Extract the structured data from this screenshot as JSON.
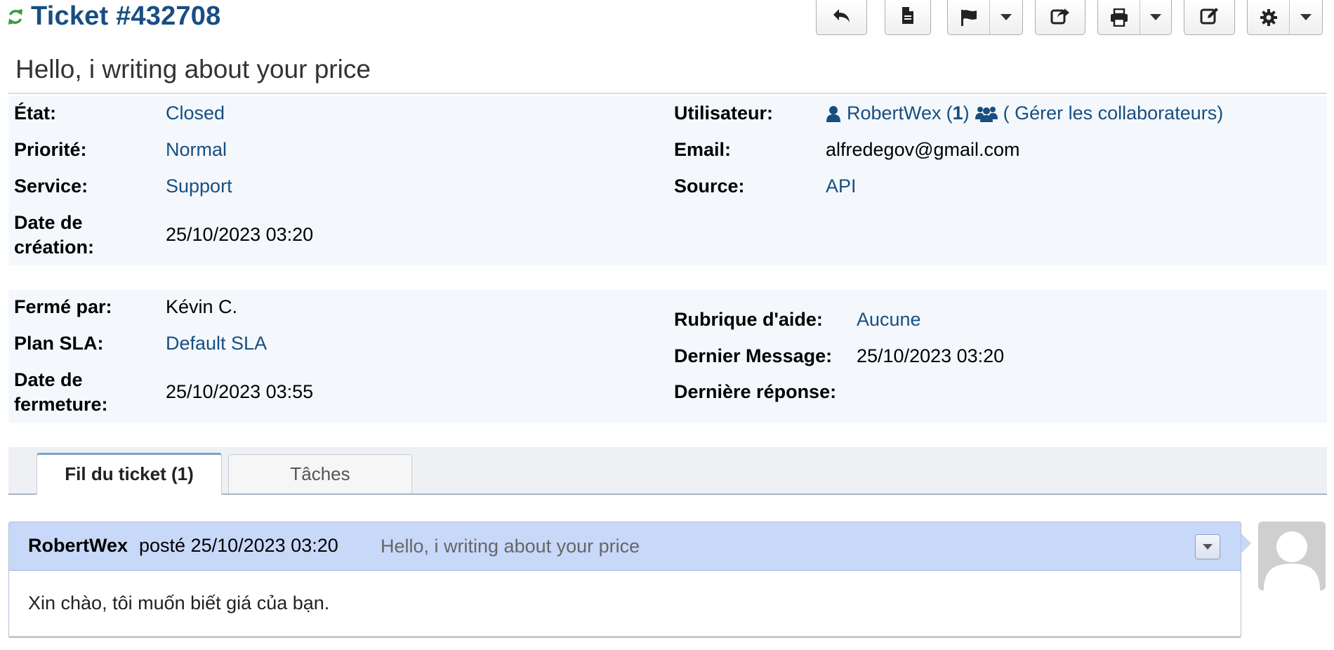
{
  "header": {
    "title": "Ticket #432708",
    "refresh_icon": "refresh-icon",
    "actions": [
      {
        "name": "reply",
        "icon": "reply-icon"
      },
      {
        "name": "note",
        "icon": "document-icon"
      },
      {
        "name": "flag",
        "icon": "flag-icon",
        "dropdown": true
      },
      {
        "name": "transfer",
        "icon": "share-icon"
      },
      {
        "name": "print",
        "icon": "print-icon",
        "dropdown": true
      },
      {
        "name": "edit",
        "icon": "edit-icon"
      },
      {
        "name": "settings",
        "icon": "gear-icon",
        "dropdown": true
      }
    ]
  },
  "subject": "Hello, i writing about your price",
  "info": {
    "state_label": "État:",
    "state_value": "Closed",
    "priority_label": "Priorité:",
    "priority_value": "Normal",
    "service_label": "Service:",
    "service_value": "Support",
    "created_label_1": "Date de",
    "created_label_2": "création:",
    "created_value": "25/10/2023 03:20",
    "user_label": "Utilisateur:",
    "user_name": "RobertWex",
    "user_count_open": "(",
    "user_count": "1",
    "user_count_close": ")",
    "collaborators": "( Gérer les collaborateurs)",
    "email_label": "Email:",
    "email_value": "alfredegov@gmail.com",
    "source_label": "Source:",
    "source_value": "API"
  },
  "info2": {
    "closed_by_label": "Fermé par:",
    "closed_by_value": "Kévin C.",
    "sla_label": "Plan SLA:",
    "sla_value": "Default SLA",
    "closed_label_1": "Date de",
    "closed_label_2": "fermeture:",
    "closed_value": "25/10/2023 03:55",
    "help_topic_label": "Rubrique d'aide:",
    "help_topic_value": "Aucune",
    "last_message_label": "Dernier Message:",
    "last_message_value": "25/10/2023 03:20",
    "last_response_label": "Dernière réponse:",
    "last_response_value": ""
  },
  "tabs": [
    {
      "label": "Fil du ticket (1)",
      "active": true
    },
    {
      "label": "Tâches",
      "active": false
    }
  ],
  "thread": {
    "poster": "RobertWex",
    "posted": "posté 25/10/2023 03:20",
    "subject": "Hello, i writing about your price",
    "body": "Xin chào, tôi muốn biết giá của bạn."
  },
  "colors": {
    "brand": "#184e81",
    "panel": "#f4f8fc",
    "thread_header": "#c8d8f8",
    "refresh": "#3a9b3a"
  }
}
